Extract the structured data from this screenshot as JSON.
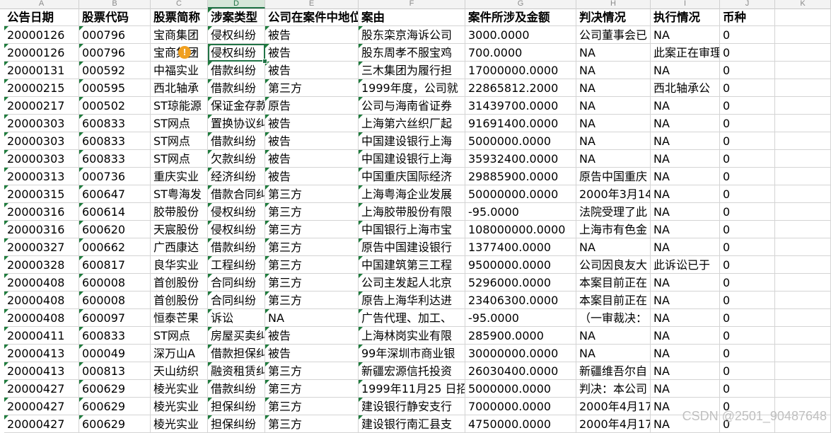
{
  "column_letters": [
    "A",
    "B",
    "C",
    "D",
    "E",
    "F",
    "G",
    "H",
    "I",
    "J",
    "K"
  ],
  "selected_column": "D",
  "headers": [
    "公告日期",
    "股票代码",
    "股票简称",
    "涉案类型",
    "公司在案件中地位",
    "案由",
    "案件所涉及金额",
    "判决情况",
    "执行情况",
    "币种"
  ],
  "rows": [
    [
      "20000126",
      "000796",
      "宝商集团",
      "侵权纠纷",
      "被告",
      "股东栾京海诉公司",
      "3000.0000",
      "公司董事会已",
      "NA",
      "0"
    ],
    [
      "20000126",
      "000796",
      "宝商集团",
      "侵权纠纷",
      "被告",
      "股东周孝不服宝鸡",
      "700.0000",
      "NA",
      "此案正在审理",
      "0"
    ],
    [
      "20000131",
      "000592",
      "中福实业",
      "借款纠纷",
      "被告",
      "三木集团为履行担",
      "17000000.0000",
      "NA",
      "NA",
      "0"
    ],
    [
      "20000215",
      "000595",
      "西北轴承",
      "借款纠纷",
      "第三方",
      "1999年度，公司就",
      "22865812.2000",
      "NA",
      "西北轴承公",
      "0"
    ],
    [
      "20000217",
      "000502",
      "ST琼能源",
      "保证金存款",
      "原告",
      "公司与海南省证券",
      "31439700.0000",
      "NA",
      "NA",
      "0"
    ],
    [
      "20000303",
      "600833",
      "ST网点",
      "置换协议纠",
      "被告",
      "上海第六丝织厂起",
      "91691400.0000",
      "NA",
      "NA",
      "0"
    ],
    [
      "20000303",
      "600833",
      "ST网点",
      "借款纠纷",
      "被告",
      "中国建设银行上海",
      "5000000.0000",
      "NA",
      "NA",
      "0"
    ],
    [
      "20000303",
      "600833",
      "ST网点",
      "欠款纠纷",
      "被告",
      "中国建设银行上海",
      "35932400.0000",
      "NA",
      "NA",
      "0"
    ],
    [
      "20000313",
      "000736",
      "重庆实业",
      "经济纠纷",
      "被告",
      "中国重庆国际经济",
      "29885900.0000",
      "原告中国重庆",
      "NA",
      "0"
    ],
    [
      "20000315",
      "600647",
      "ST粤海发",
      "借款合同纠",
      "第三方",
      "上海粤海企业发展",
      "50000000.0000",
      "2000年3月14",
      "NA",
      "0"
    ],
    [
      "20000316",
      "600614",
      "胶带股份",
      "侵权纠纷",
      "第三方",
      "上海胶带股份有限",
      "-95.0000",
      "法院受理了此",
      "NA",
      "0"
    ],
    [
      "20000316",
      "600620",
      "天宸股份",
      "侵权纠纷",
      "第三方",
      "中国银行上海市宝",
      "108000000.0000",
      "上海市有色金",
      "NA",
      "0"
    ],
    [
      "20000327",
      "000662",
      "广西康达",
      "借款纠纷",
      "第三方",
      "原告中国建设银行",
      "1377400.0000",
      "NA",
      "NA",
      "0"
    ],
    [
      "20000328",
      "600817",
      "良华实业",
      "工程纠纷",
      "第三方",
      "中国建筑第三工程",
      "9500000.0000",
      "公司因良友大",
      "此诉讼已于",
      "0"
    ],
    [
      "20000408",
      "600008",
      "首创股份",
      "合同纠纷",
      "第三方",
      "公司主发起人北京",
      "5296000.0000",
      "本案目前正在",
      "NA",
      "0"
    ],
    [
      "20000408",
      "600008",
      "首创股份",
      "合同纠纷",
      "第三方",
      "原告上海华利达进",
      "23406300.0000",
      "本案目前正在",
      "NA",
      "0"
    ],
    [
      "20000408",
      "600097",
      "恒泰芒果",
      "诉讼",
      "NA",
      "广告代理、加工、",
      "-95.0000",
      "（一审裁决：",
      "NA",
      "0"
    ],
    [
      "20000411",
      "600833",
      "ST网点",
      "房屋买卖纠",
      "被告",
      "上海林岗实业有限",
      "285900.0000",
      "NA",
      "NA",
      "0"
    ],
    [
      "20000413",
      "000049",
      "深万山A",
      "借款担保纠",
      "被告",
      "99年深圳市商业银",
      "30000000.0000",
      "NA",
      "NA",
      "0"
    ],
    [
      "20000413",
      "000813",
      "天山纺织",
      "融资租赁纠",
      "第三方",
      "新疆宏源信托投资",
      "26030400.0000",
      "新疆维吾尔自",
      "NA",
      "0"
    ],
    [
      "20000427",
      "600629",
      "棱光实业",
      "借款纠纷",
      "第三方",
      "1999年11月25 日招",
      "5000000.0000",
      "判决：本公司",
      "NA",
      "0"
    ],
    [
      "20000427",
      "600629",
      "棱光实业",
      "担保纠纷",
      "第三方",
      "建设银行静安支行",
      "7000000.0000",
      "2000年4月17",
      "NA",
      "0"
    ],
    [
      "20000427",
      "600629",
      "棱光实业",
      "担保纠纷",
      "第三方",
      "建设银行南汇县支",
      "4750000.0000",
      "2000年4月17",
      "NA",
      "0"
    ]
  ],
  "warning_icon": "warning-circle-icon",
  "warning_symbol": "!",
  "dropdown_symbol": "▾",
  "watermark": "CSDN @2501_90487648",
  "colors": {
    "accent": "#217346",
    "comment_marker": "#1e7b3c",
    "grid": "#d4d4d4"
  }
}
